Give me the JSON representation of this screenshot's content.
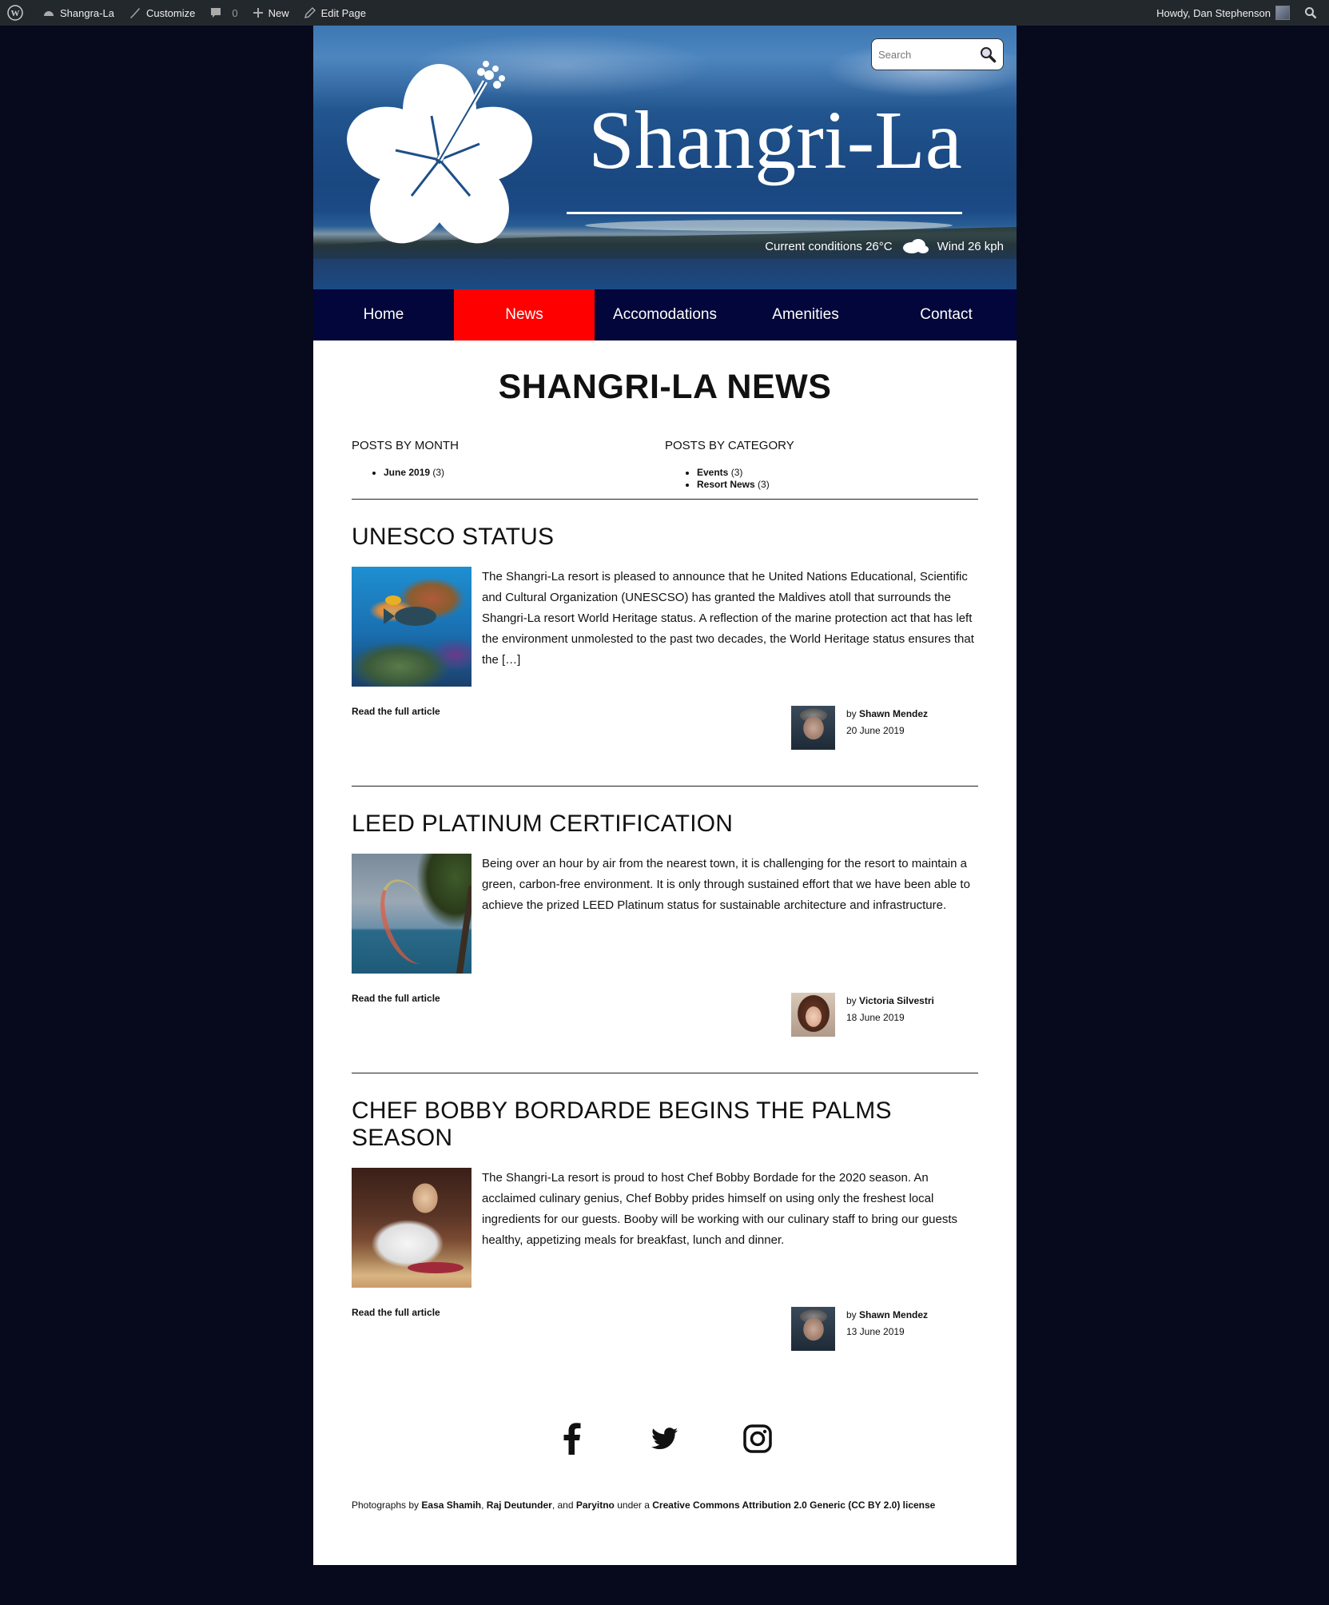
{
  "adminbar": {
    "site_name": "Shangra-La",
    "customize": "Customize",
    "comments_count": "0",
    "new": "New",
    "edit_page": "Edit Page",
    "howdy": "Howdy, Dan Stephenson"
  },
  "header": {
    "site_title": "Shangri-La",
    "search_placeholder": "Search",
    "weather_conditions": "Current conditions 26°C",
    "weather_wind": "Wind 26 kph"
  },
  "nav": {
    "items": [
      {
        "label": "Home",
        "active": false
      },
      {
        "label": "News",
        "active": true
      },
      {
        "label": "Accomodations",
        "active": false
      },
      {
        "label": "Amenities",
        "active": false
      },
      {
        "label": "Contact",
        "active": false
      }
    ],
    "active_color": "#ff0000",
    "bg_color": "#02063a"
  },
  "main": {
    "heading": "SHANGRI-LA NEWS",
    "archives": {
      "by_month_title": "POSTS BY MONTH",
      "by_month_items": [
        {
          "label": "June 2019",
          "count": "(3)"
        }
      ],
      "by_category_title": "POSTS BY CATEGORY",
      "by_category_items": [
        {
          "label": "Events",
          "count": "(3)"
        },
        {
          "label": "Resort News",
          "count": "(3)"
        }
      ]
    },
    "posts": [
      {
        "title": "UNESCO STATUS",
        "excerpt": "The Shangri-La resort is pleased to announce that he United Nations Educational, Scientific and Cultural Organization (UNESCSO) has granted the Maldives atoll that surrounds the Shangri-La resort World Heritage status. A reflection of the marine protection act that has left the environment unmolested to the past two decades, the World Heritage status ensures that the […]",
        "read_more": "Read the full article",
        "by": "by",
        "author": "Shawn Mendez",
        "date": "20 June 2019"
      },
      {
        "title": "LEED PLATINUM CERTIFICATION",
        "excerpt": "Being over an hour by air from the nearest town, it is challenging for the resort to maintain a green, carbon-free environment. It is only through sustained effort that we have been able to achieve the prized LEED Platinum status for sustainable architecture and infrastructure.",
        "read_more": "Read the full article",
        "by": "by",
        "author": "Victoria Silvestri",
        "date": "18 June 2019"
      },
      {
        "title": "CHEF BOBBY BORDARDE BEGINS THE PALMS SEASON",
        "excerpt": "The Shangri-La resort is proud to host Chef Bobby Bordade for the 2020 season. An acclaimed culinary genius, Chef Bobby prides himself on using only the freshest local ingredients for our guests. Booby will be working with our culinary staff to bring our guests healthy, appetizing meals for breakfast, lunch and dinner.",
        "read_more": "Read the full article",
        "by": "by",
        "author": "Shawn Mendez",
        "date": "13 June 2019"
      }
    ]
  },
  "footer": {
    "social": [
      "facebook-icon",
      "twitter-icon",
      "instagram-icon"
    ],
    "credits": {
      "prefix": "Photographs by",
      "p1": "Easa Shamih",
      "sep1": ",",
      "p2": "Raj Deutunder",
      "sep2": ", and",
      "p3": "Paryitno",
      "mid": "under a",
      "license": "Creative Commons Attribution 2.0 Generic (CC BY 2.0) license"
    }
  }
}
